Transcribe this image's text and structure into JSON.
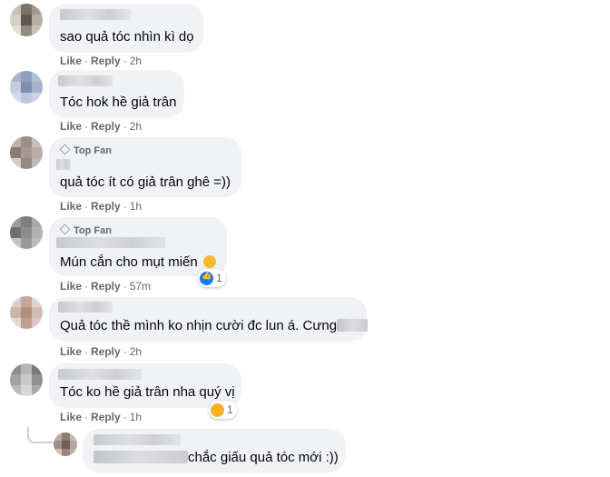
{
  "comments": [
    {
      "text": "sao quả tóc nhìn kì dọ",
      "actions": {
        "like": "Like",
        "reply": "Reply",
        "time": "2h"
      }
    },
    {
      "text": "Tóc hok hề giả trân",
      "actions": {
        "like": "Like",
        "reply": "Reply",
        "time": "2h"
      }
    },
    {
      "badge": "Top Fan",
      "text": "quả tóc ít có giả trân ghê =))",
      "actions": {
        "like": "Like",
        "reply": "Reply",
        "time": "1h"
      }
    },
    {
      "badge": "Top Fan",
      "text": "Mún cắn cho mụt miến",
      "reaction": {
        "icon": "like-icon",
        "count": "1"
      },
      "actions": {
        "like": "Like",
        "reply": "Reply",
        "time": "57m"
      }
    },
    {
      "text": "Quả tóc thề mình ko nhịn cười đc lun á. Cưng",
      "actions": {
        "like": "Like",
        "reply": "Reply",
        "time": "2h"
      }
    },
    {
      "text": "Tóc ko hề giả trân nha quý vị",
      "reaction": {
        "icon": "haha-icon",
        "count": "1"
      },
      "actions": {
        "like": "Like",
        "reply": "Reply",
        "time": "1h"
      }
    },
    {
      "text": "chắc giấu quả tóc mới :))"
    }
  ],
  "separator": "·",
  "colors": {
    "bubble": "#f0f2f5",
    "meta": "#65676b",
    "like": "#1877f2",
    "haha": "#f7b125"
  }
}
